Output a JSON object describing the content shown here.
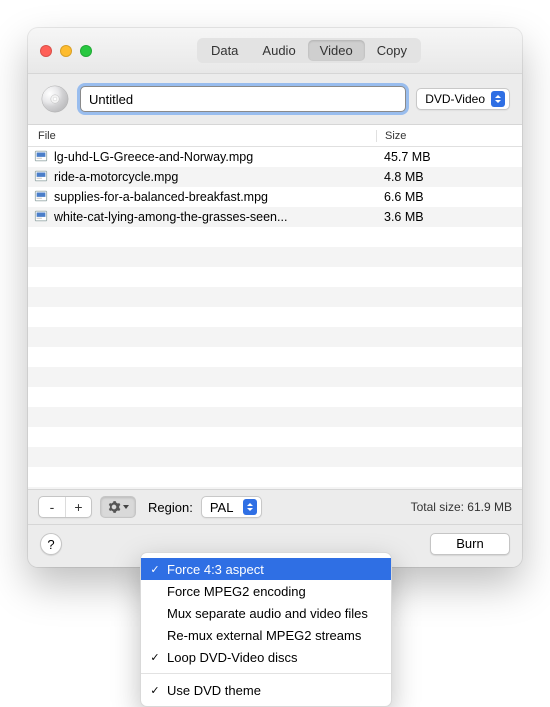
{
  "colors": {
    "close": "#ff5f57",
    "minimize": "#febc2e",
    "zoom": "#28c840",
    "accent": "#2f6fe4"
  },
  "tabs": [
    "Data",
    "Audio",
    "Video",
    "Copy"
  ],
  "active_tab_index": 2,
  "disc": {
    "title_value": "Untitled",
    "type": "DVD-Video"
  },
  "table": {
    "columns": {
      "file": "File",
      "size": "Size"
    },
    "rows": [
      {
        "name": "lg-uhd-LG-Greece-and-Norway.mpg",
        "size": "45.7 MB"
      },
      {
        "name": "ride-a-motorcycle.mpg",
        "size": "4.8 MB"
      },
      {
        "name": "supplies-for-a-balanced-breakfast.mpg",
        "size": "6.6 MB"
      },
      {
        "name": "white-cat-lying-among-the-grasses-seen...",
        "size": "3.6 MB"
      }
    ]
  },
  "toolbar": {
    "remove": "-",
    "add": "+",
    "region_label": "Region:",
    "region_value": "PAL",
    "total_size": "Total size: 61.9 MB"
  },
  "footer": {
    "help": "?",
    "burn": "Burn"
  },
  "menu": {
    "items": [
      {
        "label": "Force 4:3 aspect",
        "checked": true,
        "highlighted": true
      },
      {
        "label": "Force MPEG2 encoding",
        "checked": false,
        "highlighted": false
      },
      {
        "label": "Mux separate audio and video files",
        "checked": false,
        "highlighted": false
      },
      {
        "label": "Re-mux external MPEG2 streams",
        "checked": false,
        "highlighted": false
      },
      {
        "label": "Loop DVD-Video discs",
        "checked": true,
        "highlighted": false
      }
    ],
    "items2": [
      {
        "label": "Use DVD theme",
        "checked": true,
        "highlighted": false
      }
    ]
  }
}
